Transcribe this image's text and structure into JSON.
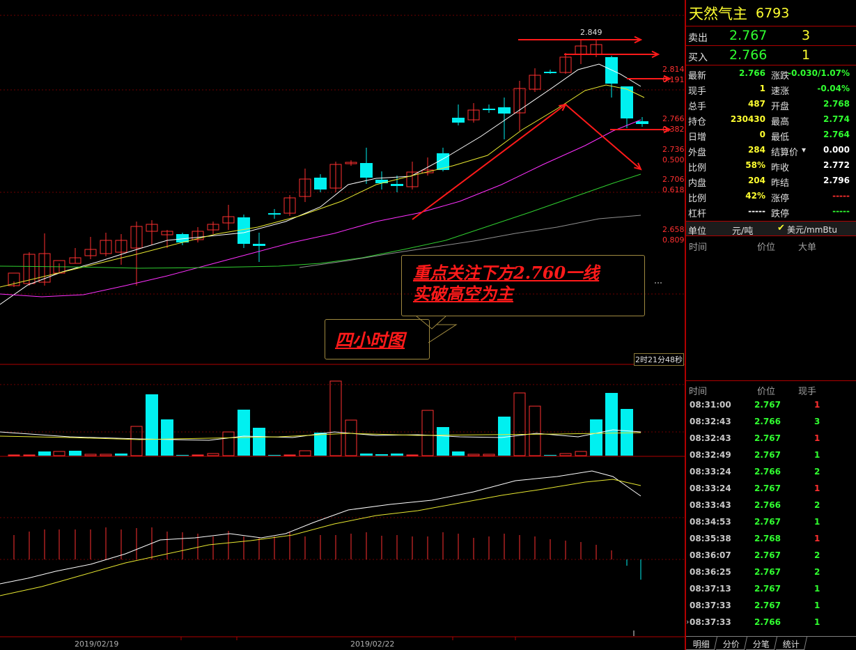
{
  "chart": {
    "price_labels": {
      "high": "2.849",
      "r1_price": "2.814",
      "r1_ratio": "0.191",
      "r2_price": "2.766",
      "r2_ratio": "0.382",
      "r3_price": "2.736",
      "r3_ratio": "0.500",
      "r4_price": "2.706",
      "r4_ratio": "0.618",
      "r5_price": "2.658",
      "r5_ratio": "0.809"
    },
    "annotation_note": "重点关注下方2.760一线\n实破高空为主",
    "annotation_label": "四小时图",
    "countdown": "2时21分48秒",
    "dates": [
      "2019/02/19",
      "2019/02/22"
    ],
    "colors": {
      "bull": "#ff3030",
      "bear": "#00f0f0",
      "ma5": "#ffffff",
      "ma10": "#e8e830",
      "ma20": "#ff30ff",
      "ma40": "#30d030",
      "ma60": "#909090",
      "arrow": "#ff1a1a"
    }
  },
  "panel": {
    "name": "天然气主",
    "code": "6793",
    "ask": {
      "label": "卖出",
      "price": "2.767",
      "volume": "3"
    },
    "bid": {
      "label": "买入",
      "price": "2.766",
      "volume": "1"
    },
    "info": [
      {
        "l": "最新",
        "lv": "2.766",
        "lc": "green",
        "r": "涨跌",
        "rv": "-0.030/1.07%",
        "rc": "green"
      },
      {
        "l": "现手",
        "lv": "1",
        "lc": "yellow",
        "r": "速涨",
        "rv": "-0.04%",
        "rc": "green"
      },
      {
        "l": "总手",
        "lv": "487",
        "lc": "yellow",
        "r": "开盘",
        "rv": "2.768",
        "rc": "green"
      },
      {
        "l": "持仓",
        "lv": "230430",
        "lc": "yellow",
        "r": "最高",
        "rv": "2.774",
        "rc": "green"
      },
      {
        "l": "日增",
        "lv": "0",
        "lc": "yellow",
        "r": "最低",
        "rv": "2.764",
        "rc": "green"
      },
      {
        "l": "外盘",
        "lv": "284",
        "lc": "yellow",
        "r": "结算价",
        "rv": "0.000",
        "rc": "white"
      },
      {
        "l": "比例",
        "lv": "58%",
        "lc": "yellow",
        "r": "昨收",
        "rv": "2.772",
        "rc": "white"
      },
      {
        "l": "内盘",
        "lv": "204",
        "lc": "yellow",
        "r": "昨结",
        "rv": "2.796",
        "rc": "white"
      },
      {
        "l": "比例",
        "lv": "42%",
        "lc": "yellow",
        "r": "涨停",
        "rv": "-----",
        "rc": "red"
      },
      {
        "l": "杠杆",
        "lv": "-----",
        "lc": "white",
        "r": "跌停",
        "rv": "-----",
        "rc": "green"
      }
    ],
    "unit": {
      "label": "单位",
      "cny": "元/吨",
      "usd": "美元/mmBtu"
    },
    "big_header": {
      "time": "时间",
      "price": "价位",
      "big": "大单"
    },
    "tick_header": {
      "time": "时间",
      "price": "价位",
      "volume": "现手"
    },
    "ticks": [
      {
        "time": "08:31:00",
        "price": "2.767",
        "volume": "1",
        "color": "red"
      },
      {
        "time": "08:32:43",
        "price": "2.766",
        "volume": "3",
        "color": "green"
      },
      {
        "time": "08:32:43",
        "price": "2.767",
        "volume": "1",
        "color": "red"
      },
      {
        "time": "08:32:49",
        "price": "2.767",
        "volume": "1",
        "color": "green"
      },
      {
        "time": "08:33:24",
        "price": "2.766",
        "volume": "2",
        "color": "green"
      },
      {
        "time": "08:33:24",
        "price": "2.767",
        "volume": "1",
        "color": "red"
      },
      {
        "time": "08:33:43",
        "price": "2.766",
        "volume": "2",
        "color": "green"
      },
      {
        "time": "08:34:53",
        "price": "2.767",
        "volume": "1",
        "color": "green"
      },
      {
        "time": "08:35:38",
        "price": "2.768",
        "volume": "1",
        "color": "red"
      },
      {
        "time": "08:36:07",
        "price": "2.767",
        "volume": "2",
        "color": "green"
      },
      {
        "time": "08:36:25",
        "price": "2.767",
        "volume": "2",
        "color": "green"
      },
      {
        "time": "08:37:13",
        "price": "2.767",
        "volume": "1",
        "color": "green"
      },
      {
        "time": "08:37:33",
        "price": "2.767",
        "volume": "1",
        "color": "green"
      },
      {
        "time": "08:37:33",
        "price": "2.766",
        "volume": "1",
        "color": "green"
      }
    ],
    "tabs": [
      "明细",
      "分价",
      "分笔",
      "统计"
    ]
  }
}
